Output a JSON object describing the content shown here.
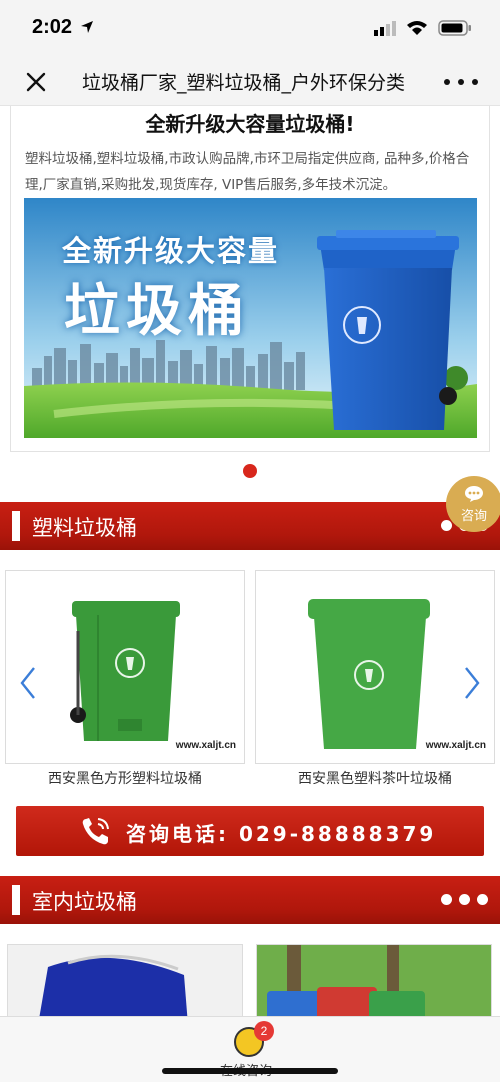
{
  "status": {
    "time": "2:02"
  },
  "nav": {
    "title": "垃圾桶厂家_塑料垃圾桶_户外环保分类"
  },
  "banner": {
    "heading": "全新升级大容量垃圾桶!",
    "description": "塑料垃圾桶,塑料垃圾桶,市政认购品牌,市环卫局指定供应商, 品种多,价格合理,厂家直销,采购批发,现货库存, VIP售后服务,多年技术沉淀。",
    "image_line1": "全新升级大容量",
    "image_line2": "垃圾桶"
  },
  "consult": {
    "label": "咨询"
  },
  "sections": {
    "plastic": {
      "title": "塑料垃圾桶"
    },
    "indoor": {
      "title": "室内垃圾桶"
    }
  },
  "products": [
    {
      "name": "西安黑色方形塑料垃圾桶",
      "watermark": "www.xaljt.cn",
      "color": "#3a9a3a"
    },
    {
      "name": "西安黑色塑料茶叶垃圾桶",
      "watermark": "www.xaljt.cn",
      "color": "#45a845"
    }
  ],
  "phone": {
    "text": "咨询电话: 029-88888379"
  },
  "chat": {
    "label": "在线咨询",
    "badge": "2"
  },
  "colors": {
    "accent_red": "#c81f13",
    "bin_blue": "#1f63c8",
    "gold": "#d9ac52"
  }
}
